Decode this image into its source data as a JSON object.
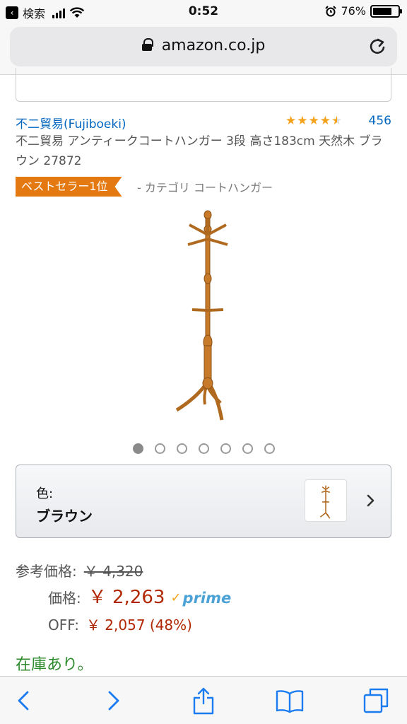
{
  "status_bar": {
    "back_app": "検索",
    "time": "0:52",
    "battery_percent_text": "76%",
    "battery_level": 0.76
  },
  "browser": {
    "url": "amazon.co.jp"
  },
  "product": {
    "brand": "不二貿易(Fujiboeki)",
    "rating": 4.5,
    "rating_count": "456",
    "title": "不二貿易 アンティークコートハンガー 3段 高さ183cm 天然木 ブラウン 27872",
    "badge": "ベストセラー1位",
    "badge_category": "- カテゴリ コートハンガー",
    "image_count": 7,
    "image_active_index": 0
  },
  "color_selector": {
    "label": "色:",
    "value": "ブラウン"
  },
  "pricing": {
    "list_label": "参考価格:",
    "list_price": "￥ 4,320",
    "price_label": "価格:",
    "price": "￥ 2,263",
    "prime_label": "prime",
    "off_label": "OFF:",
    "off_value": "￥ 2,057 (48%)"
  },
  "availability": "在庫あり。",
  "colors": {
    "link": "#0066c0",
    "badge": "#e47911",
    "price": "#b12704",
    "stock": "#2d8a2d",
    "toolbar_icon": "#1a7cf0",
    "wood": "#c67a2a"
  },
  "toolbar": {
    "icons": [
      "back-icon",
      "forward-icon",
      "share-icon",
      "bookmarks-icon",
      "tabs-icon"
    ]
  }
}
